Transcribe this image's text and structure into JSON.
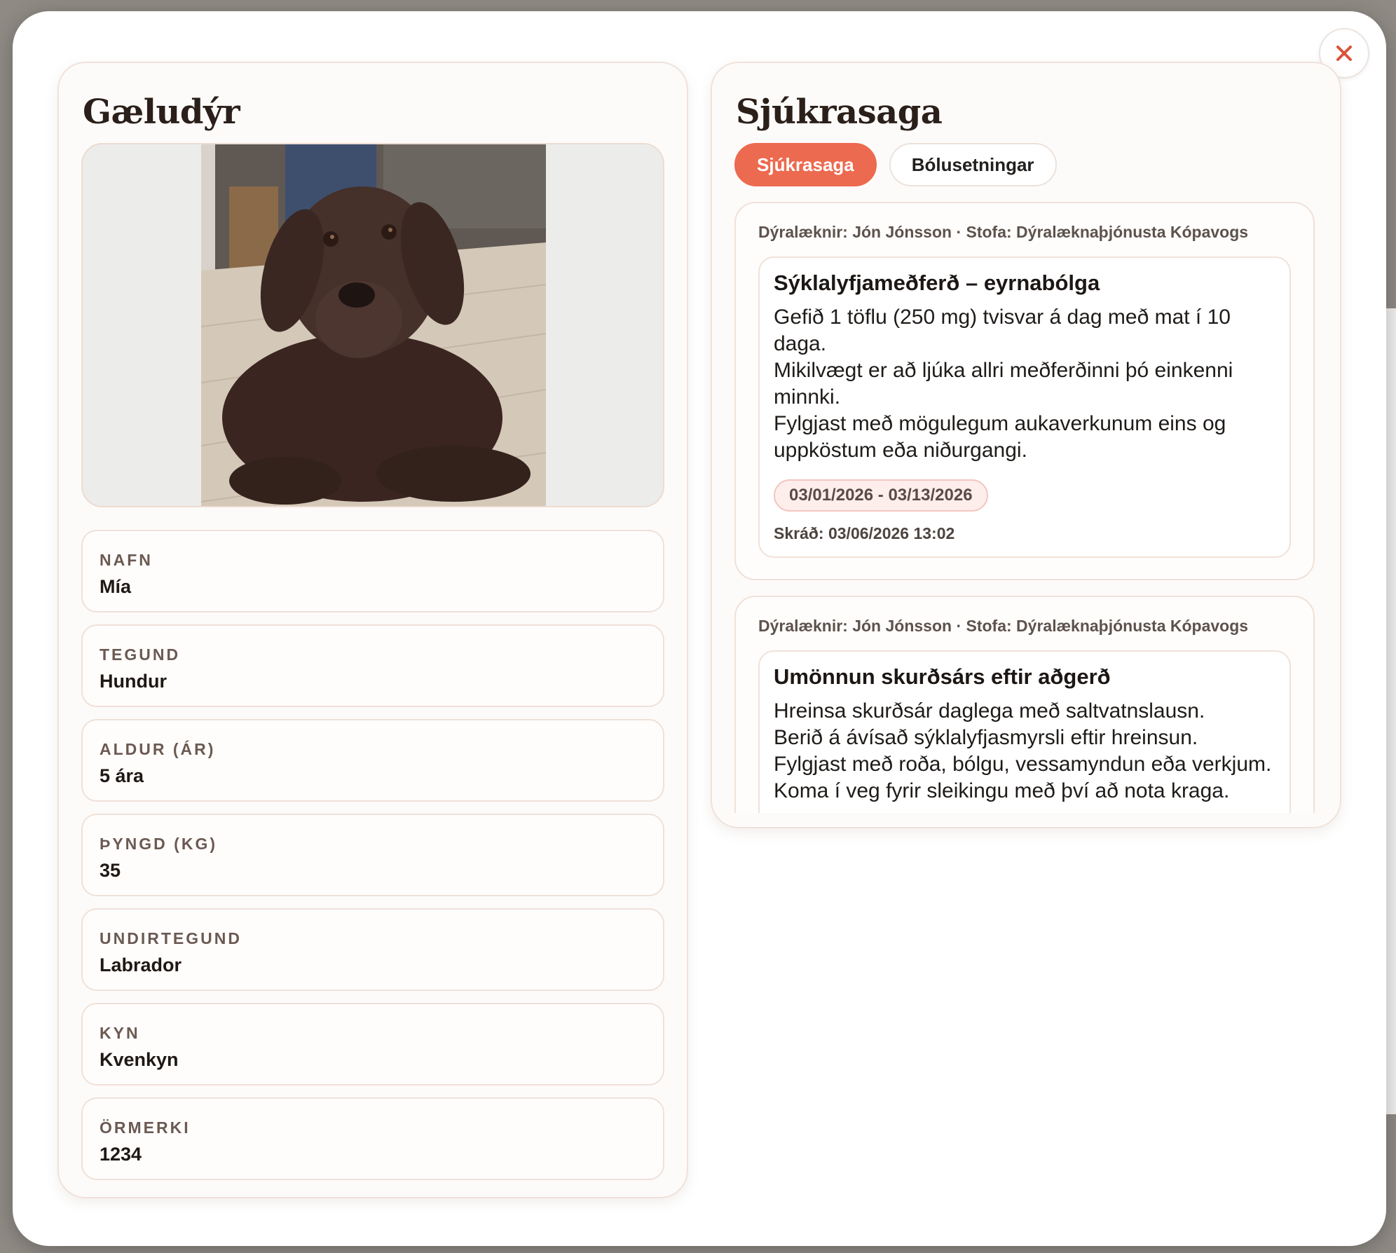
{
  "pet_panel": {
    "title": "Gæludýr",
    "photo_alt": "Brown Labrador dog lying on floor",
    "fields": [
      {
        "label": "NAFN",
        "value": "Mía"
      },
      {
        "label": "TEGUND",
        "value": "Hundur"
      },
      {
        "label": "ALDUR (ÁR)",
        "value": "5 ára"
      },
      {
        "label": "ÞYNGD (KG)",
        "value": "35"
      },
      {
        "label": "UNDIRTEGUND",
        "value": "Labrador"
      },
      {
        "label": "KYN",
        "value": "Kvenkyn"
      },
      {
        "label": "ÖRMERKI",
        "value": "1234"
      }
    ]
  },
  "history_panel": {
    "title": "Sjúkrasaga",
    "tabs": [
      {
        "label": "Sjúkrasaga",
        "active": true
      },
      {
        "label": "Bólusetningar",
        "active": false
      }
    ],
    "records": [
      {
        "meta": "Dýralæknir: Jón Jónsson · Stofa: Dýralæknaþjónusta Kópavogs",
        "title": "Sýklalyfjameðferð – eyrnabólga",
        "lines": [
          "Gefið 1 töflu (250 mg) tvisvar á dag með mat í 10 daga.",
          "Mikilvægt er að ljúka allri meðferðinni þó einkenni minnki.",
          "Fylgjast með mögulegum aukaverkunum eins og uppköstum eða niðurgangi."
        ],
        "date_range": "03/01/2026 - 03/13/2026",
        "logged": "Skráð: 03/06/2026 13:02"
      },
      {
        "meta": "Dýralæknir: Jón Jónsson · Stofa: Dýralæknaþjónusta Kópavogs",
        "title": "Umönnun skurðsárs eftir aðgerð",
        "lines": [
          "Hreinsa skurðsár daglega með saltvatnslausn.",
          "Berið á ávísað sýklalyfjasmyrsli eftir hreinsun.",
          "Fylgjast með roða, bólgu, vessamyndun eða verkjum.",
          "Koma í veg fyrir sleikingu með því að nota kraga."
        ]
      }
    ]
  },
  "colors": {
    "accent": "#ec6a4f",
    "panel_bg": "#fdfbf9",
    "border": "#efe2da",
    "close_icon": "#d9533b"
  },
  "icons": {
    "close": "close-icon"
  }
}
